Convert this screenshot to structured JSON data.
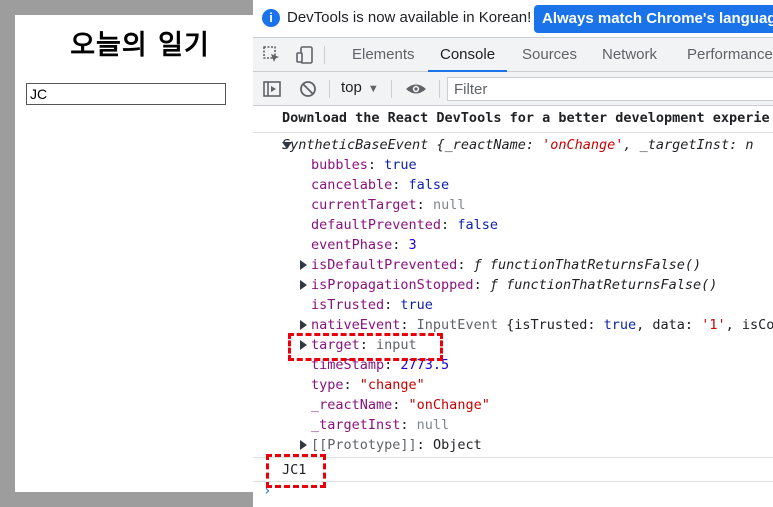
{
  "page": {
    "title": "오늘의 일기",
    "input_value": "JC"
  },
  "infobar": {
    "message": "DevTools is now available in Korean!",
    "button_label": "Always match Chrome's language"
  },
  "tabs": [
    "Elements",
    "Console",
    "Sources",
    "Network",
    "Performance"
  ],
  "active_tab": "Console",
  "toolbar": {
    "context": "top",
    "filter_placeholder": "Filter"
  },
  "console": {
    "warning": "Download the React DevTools for a better development experie",
    "event_header": {
      "name": "SyntheticBaseEvent",
      "preview_prefix": "{_reactName: ",
      "preview_value": "'onChange'",
      "preview_suffix": ", _targetInst: n"
    },
    "props": {
      "bubbles": {
        "key": "bubbles",
        "value": "true"
      },
      "cancelable": {
        "key": "cancelable",
        "value": "false"
      },
      "currentTarget": {
        "key": "currentTarget",
        "value": "null"
      },
      "defaultPrevented": {
        "key": "defaultPrevented",
        "value": "false"
      },
      "eventPhase": {
        "key": "eventPhase",
        "value": "3"
      },
      "isDefaultPrevented": {
        "key": "isDefaultPrevented",
        "value": "ƒ functionThatReturnsFalse()"
      },
      "isPropagationStopped": {
        "key": "isPropagationStopped",
        "value": "ƒ functionThatReturnsFalse()"
      },
      "isTrusted": {
        "key": "isTrusted",
        "value": "true"
      },
      "nativeEvent": {
        "key": "nativeEvent",
        "type": "InputEvent",
        "preview_a": "{isTrusted: ",
        "preview_b": "true",
        "preview_c": ", data: ",
        "preview_d": "'1'",
        "preview_e": ", isCo"
      },
      "target": {
        "key": "target",
        "value": "input"
      },
      "timeStamp": {
        "key": "timeStamp",
        "value": "2773.5"
      },
      "type": {
        "key": "type",
        "value": "\"change\""
      },
      "reactName": {
        "key": "_reactName",
        "value": "\"onChange\""
      },
      "targetInst": {
        "key": "_targetInst",
        "value": "null"
      },
      "prototype": {
        "key": "[[Prototype]]",
        "value": "Object"
      }
    },
    "result": "JC1",
    "prompt": "›"
  },
  "colors": {
    "accent": "#1a73e8",
    "highlight": "#e8000b",
    "backdrop": "#9d9d9d"
  }
}
